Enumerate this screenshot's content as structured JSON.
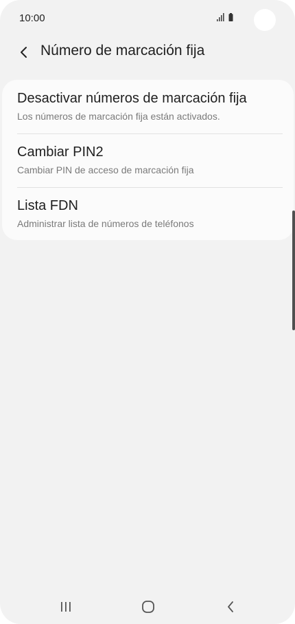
{
  "status_bar": {
    "time": "10:00",
    "icons": [
      "signal-icon",
      "battery-icon"
    ]
  },
  "app_bar": {
    "back_icon": "chevron-left-icon",
    "title": "Número de marcación fija"
  },
  "settings": {
    "items": [
      {
        "title": "Desactivar números de marcación fija",
        "subtitle": "Los números de marcación fija están activados."
      },
      {
        "title": "Cambiar PIN2",
        "subtitle": "Cambiar PIN de acceso de marcación fija"
      },
      {
        "title": "Lista FDN",
        "subtitle": "Administrar lista de números de teléfonos"
      }
    ]
  },
  "nav_bar": {
    "icons": [
      "recent-apps-icon",
      "home-icon",
      "back-icon"
    ]
  },
  "colors": {
    "background": "#f2f2f2",
    "card": "#fbfbfb",
    "title_text": "#1e1e1e",
    "subtitle_text": "#7a7a7a"
  }
}
